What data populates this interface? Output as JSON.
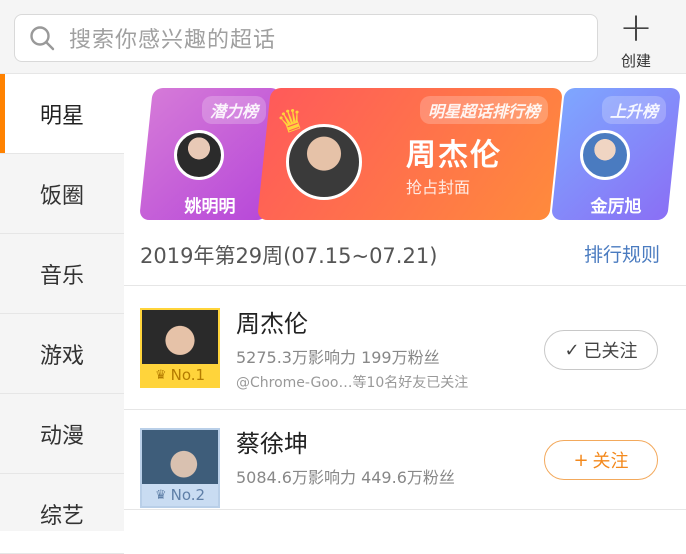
{
  "search": {
    "placeholder": "搜索你感兴趣的超话"
  },
  "create": {
    "label": "创建"
  },
  "sidebar": {
    "items": [
      {
        "label": "明星",
        "active": true
      },
      {
        "label": "饭圈"
      },
      {
        "label": "音乐"
      },
      {
        "label": "游戏"
      },
      {
        "label": "动漫"
      },
      {
        "label": "综艺"
      }
    ]
  },
  "banner": {
    "left": {
      "tag": "潜力榜",
      "name": "姚明明"
    },
    "center": {
      "tag": "明星超话排行榜",
      "name": "周杰伦",
      "subtitle": "抢占封面"
    },
    "right": {
      "tag": "上升榜",
      "name": "金厉旭"
    }
  },
  "ranking": {
    "week": "2019年第29周(07.15~07.21)",
    "rules_link": "排行规则",
    "rows": [
      {
        "rank": "No.1",
        "name": "周杰伦",
        "stats": "5275.3万影响力  199万粉丝",
        "friends": "@Chrome-Goo…等10名好友已关注",
        "button": "已关注",
        "button_icon": "check-icon"
      },
      {
        "rank": "No.2",
        "name": "蔡徐坤",
        "stats": "5084.6万影响力  449.6万粉丝",
        "button": "关注",
        "button_icon": "plus-icon"
      }
    ]
  },
  "colors": {
    "accent": "#ff8200",
    "link": "#4a7bc0",
    "gold": "#ffd43b"
  }
}
